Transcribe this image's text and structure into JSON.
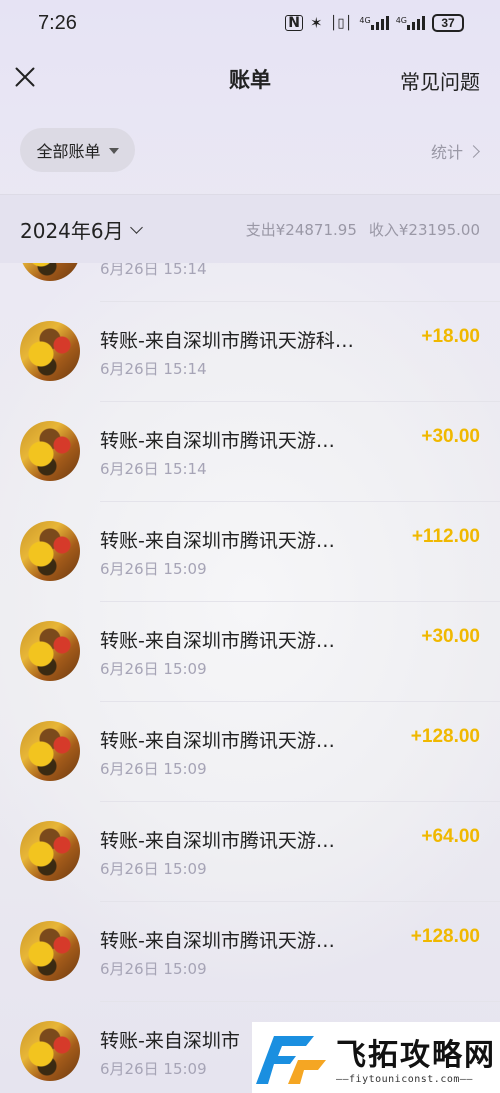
{
  "status_bar": {
    "time": "7:26",
    "battery": "37",
    "icons": [
      "nfc-icon",
      "bluetooth-icon",
      "vibrate-icon",
      "signal-4g-icon",
      "signal-4g-icon",
      "battery-icon"
    ]
  },
  "header": {
    "title": "账单",
    "help": "常见问题"
  },
  "filter": {
    "all_bills": "全部账单",
    "stats": "统计"
  },
  "month": {
    "label": "2024年6月",
    "expense": "支出¥24871.95",
    "income": "收入¥23195.00"
  },
  "transactions": [
    {
      "title": "",
      "time": "6月26日 15:14",
      "amount": ""
    },
    {
      "title": "转账-来自深圳市腾讯天游科…",
      "time": "6月26日 15:14",
      "amount": "+18.00"
    },
    {
      "title": "转账-来自深圳市腾讯天游…",
      "time": "6月26日 15:14",
      "amount": "+30.00"
    },
    {
      "title": "转账-来自深圳市腾讯天游…",
      "time": "6月26日 15:09",
      "amount": "+112.00"
    },
    {
      "title": "转账-来自深圳市腾讯天游…",
      "time": "6月26日 15:09",
      "amount": "+30.00"
    },
    {
      "title": "转账-来自深圳市腾讯天游…",
      "time": "6月26日 15:09",
      "amount": "+128.00"
    },
    {
      "title": "转账-来自深圳市腾讯天游…",
      "time": "6月26日 15:09",
      "amount": "+64.00"
    },
    {
      "title": "转账-来自深圳市腾讯天游…",
      "time": "6月26日 15:09",
      "amount": "+128.00"
    },
    {
      "title": "转账-来自深圳市",
      "time": "6月26日 15:09",
      "amount": ""
    }
  ],
  "watermark": {
    "name": "飞拓攻略网",
    "url": "——fiytouniconst.com——"
  },
  "colors": {
    "amount": "#f0b800",
    "secondary_text": "#a6a4b6",
    "header_bg": "#e4e2ef"
  }
}
